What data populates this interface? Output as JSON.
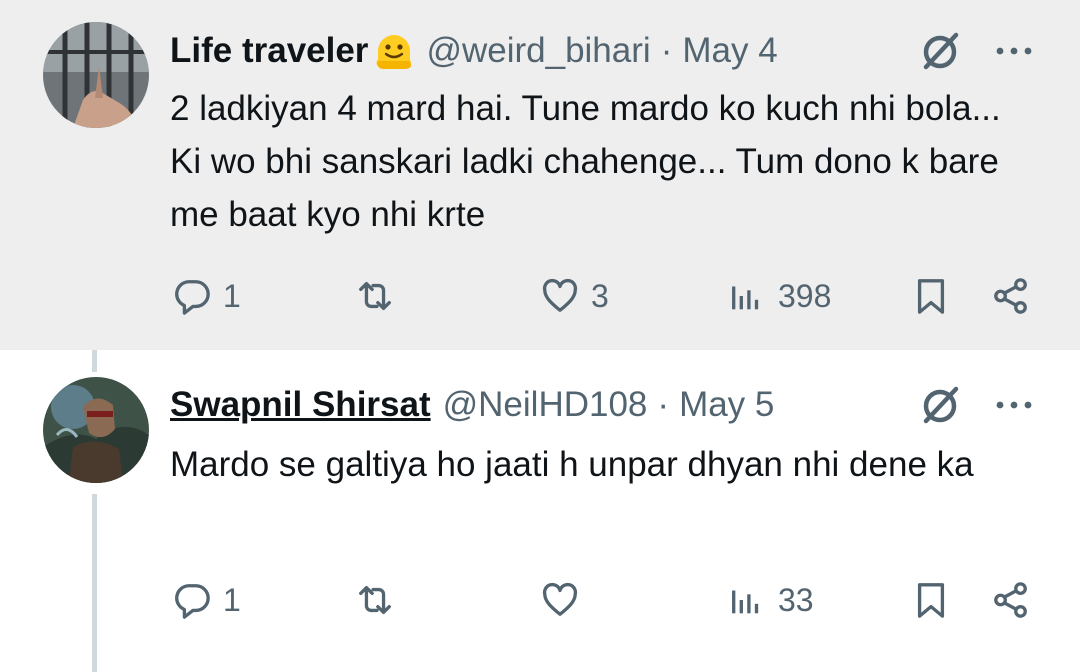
{
  "tweets": [
    {
      "display_name": "Life traveler",
      "handle": "@weird_bihari",
      "separator": "·",
      "date": "May 4",
      "text": "2 ladkiyan 4 mard hai. Tune mardo ko kuch nhi bola... Ki wo bhi  sanskari ladki chahenge... Tum dono k bare me baat kyo nhi krte",
      "replies": "1",
      "retweets": "",
      "likes": "3",
      "views": "398"
    },
    {
      "display_name": "Swapnil Shirsat",
      "handle": "@NeilHD108",
      "separator": "·",
      "date": "May 5",
      "text": "Mardo se galtiya ho jaati h unpar dhyan nhi dene ka",
      "replies": "1",
      "retweets": "",
      "likes": "",
      "views": "33"
    }
  ],
  "icons": {
    "name_emoji": "melting-face-emoji",
    "grok": "grok-icon",
    "more": "more-icon",
    "reply": "reply-icon",
    "retweet": "retweet-icon",
    "like": "like-icon",
    "views": "views-icon",
    "bookmark": "bookmark-icon",
    "share": "share-icon"
  },
  "colors": {
    "text": "#0f1419",
    "secondary": "#536471",
    "thread_line": "#cfd9de",
    "highlight_bg": "#eeeeee"
  }
}
